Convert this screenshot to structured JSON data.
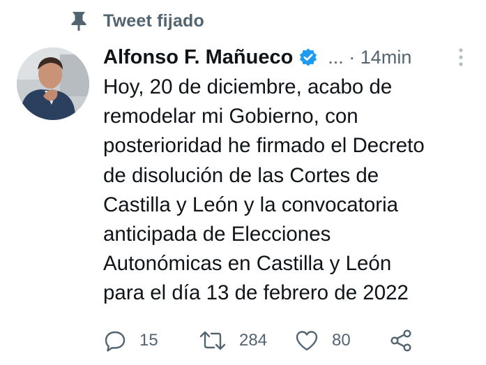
{
  "pinned": {
    "label": "Tweet fijado"
  },
  "author": {
    "name": "Alfonso F. Mañueco",
    "verified": true
  },
  "meta": {
    "separator": "... · 14min"
  },
  "tweet": {
    "lines": [
      "Hoy, 20 de diciembre, acabo de",
      "remodelar mi Gobierno, con",
      "posterioridad he firmado el Decreto",
      "de disolución de las Cortes de",
      "Castilla y León y la convocatoria",
      "anticipada de Elecciones",
      "Autonómicas en Castilla y León",
      "para el día 13 de febrero de 2022"
    ]
  },
  "actions": {
    "replies": "15",
    "retweets": "284",
    "likes": "80"
  },
  "icons": {
    "pin": "pin-icon",
    "verified": "verified-badge-icon",
    "more": "more-vertical-icon",
    "reply": "reply-icon",
    "retweet": "retweet-icon",
    "like": "heart-icon",
    "share": "share-icon"
  },
  "colors": {
    "text": "#0f1419",
    "secondary": "#536471",
    "verified": "#1d9bf0"
  }
}
